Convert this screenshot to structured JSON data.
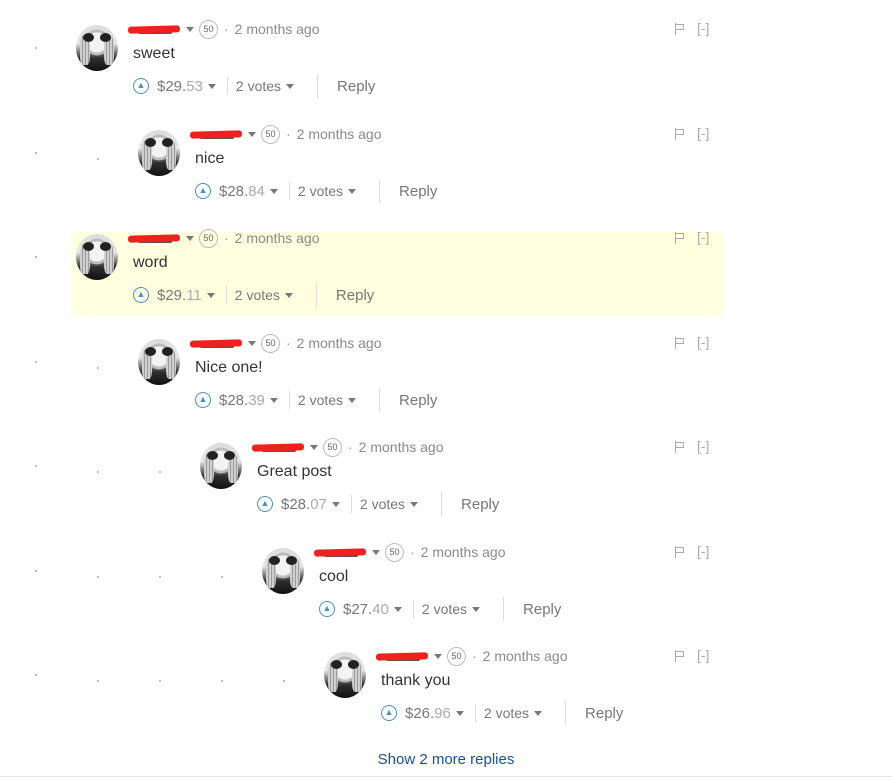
{
  "comments": [
    {
      "depth": 0,
      "highlight": false,
      "reputation": "50",
      "time": "2 months ago",
      "text": "sweet",
      "payout_main": "$29.",
      "payout_frac": "53",
      "votes": "2 votes",
      "reply": "Reply",
      "collapse": "[-]"
    },
    {
      "depth": 1,
      "highlight": false,
      "reputation": "50",
      "time": "2 months ago",
      "text": "nice",
      "payout_main": "$28.",
      "payout_frac": "84",
      "votes": "2 votes",
      "reply": "Reply",
      "collapse": "[-]"
    },
    {
      "depth": 0,
      "highlight": true,
      "reputation": "50",
      "time": "2 months ago",
      "text": "word",
      "payout_main": "$29.",
      "payout_frac": "11",
      "votes": "2 votes",
      "reply": "Reply",
      "collapse": "[-]"
    },
    {
      "depth": 1,
      "highlight": false,
      "reputation": "50",
      "time": "2 months ago",
      "text": "Nice one!",
      "payout_main": "$28.",
      "payout_frac": "39",
      "votes": "2 votes",
      "reply": "Reply",
      "collapse": "[-]"
    },
    {
      "depth": 2,
      "highlight": false,
      "reputation": "50",
      "time": "2 months ago",
      "text": "Great post",
      "payout_main": "$28.",
      "payout_frac": "07",
      "votes": "2 votes",
      "reply": "Reply",
      "collapse": "[-]"
    },
    {
      "depth": 3,
      "highlight": false,
      "reputation": "50",
      "time": "2 months ago",
      "text": "cool",
      "payout_main": "$27.",
      "payout_frac": "40",
      "votes": "2 votes",
      "reply": "Reply",
      "collapse": "[-]"
    },
    {
      "depth": 4,
      "highlight": false,
      "reputation": "50",
      "time": "2 months ago",
      "text": "thank you",
      "payout_main": "$26.",
      "payout_frac": "96",
      "votes": "2 votes",
      "reply": "Reply",
      "collapse": "[-]"
    }
  ],
  "show_more": "Show 2 more replies",
  "colors": {
    "highlight_bg": "#ffffe0",
    "upvote_blue": "#4a90c7",
    "link_blue": "#1a5099",
    "redaction_red": "#f0201e"
  },
  "icons": {
    "upvote": "chevron-up-circle-icon",
    "flag": "flag-icon",
    "dropdown": "caret-down-icon"
  }
}
